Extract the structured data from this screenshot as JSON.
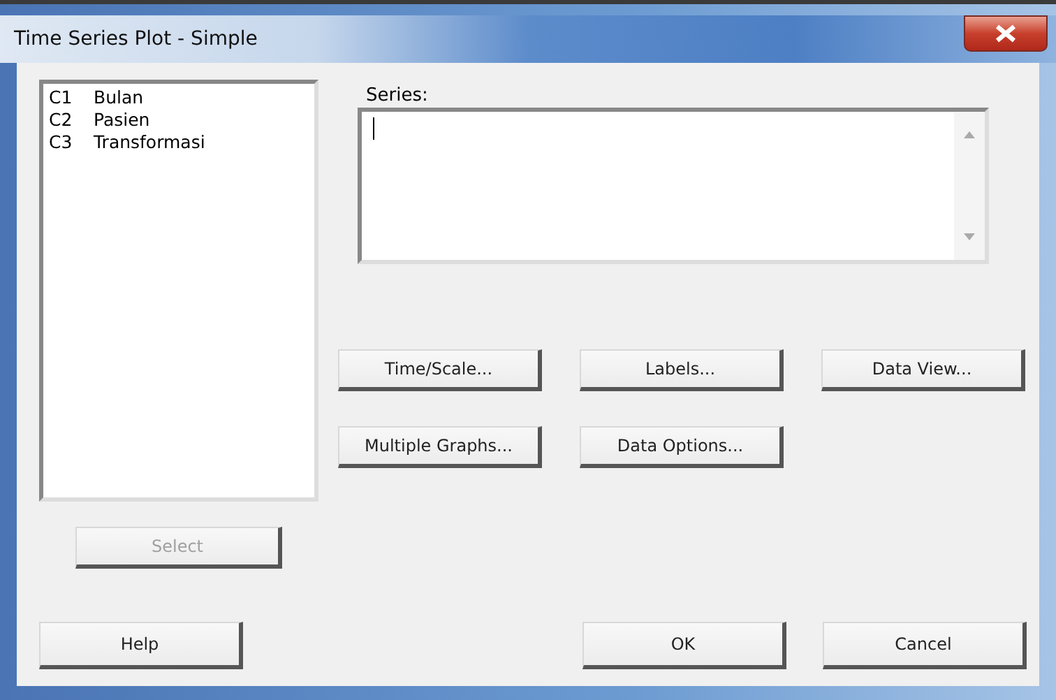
{
  "window": {
    "title": "Time Series Plot - Simple"
  },
  "variables": [
    {
      "column": "C1",
      "name": "Bulan"
    },
    {
      "column": "C2",
      "name": "Pasien"
    },
    {
      "column": "C3",
      "name": "Transformasi"
    }
  ],
  "series": {
    "label": "Series:"
  },
  "option_buttons": [
    {
      "label": "Time/Scale..."
    },
    {
      "label": "Labels..."
    },
    {
      "label": "Data View..."
    },
    {
      "label": "Multiple Graphs..."
    },
    {
      "label": "Data Options..."
    }
  ],
  "select_button": {
    "label": "Select",
    "disabled": true
  },
  "buttons": [
    {
      "label": "Help"
    },
    {
      "label": "OK"
    },
    {
      "label": "Cancel"
    }
  ]
}
